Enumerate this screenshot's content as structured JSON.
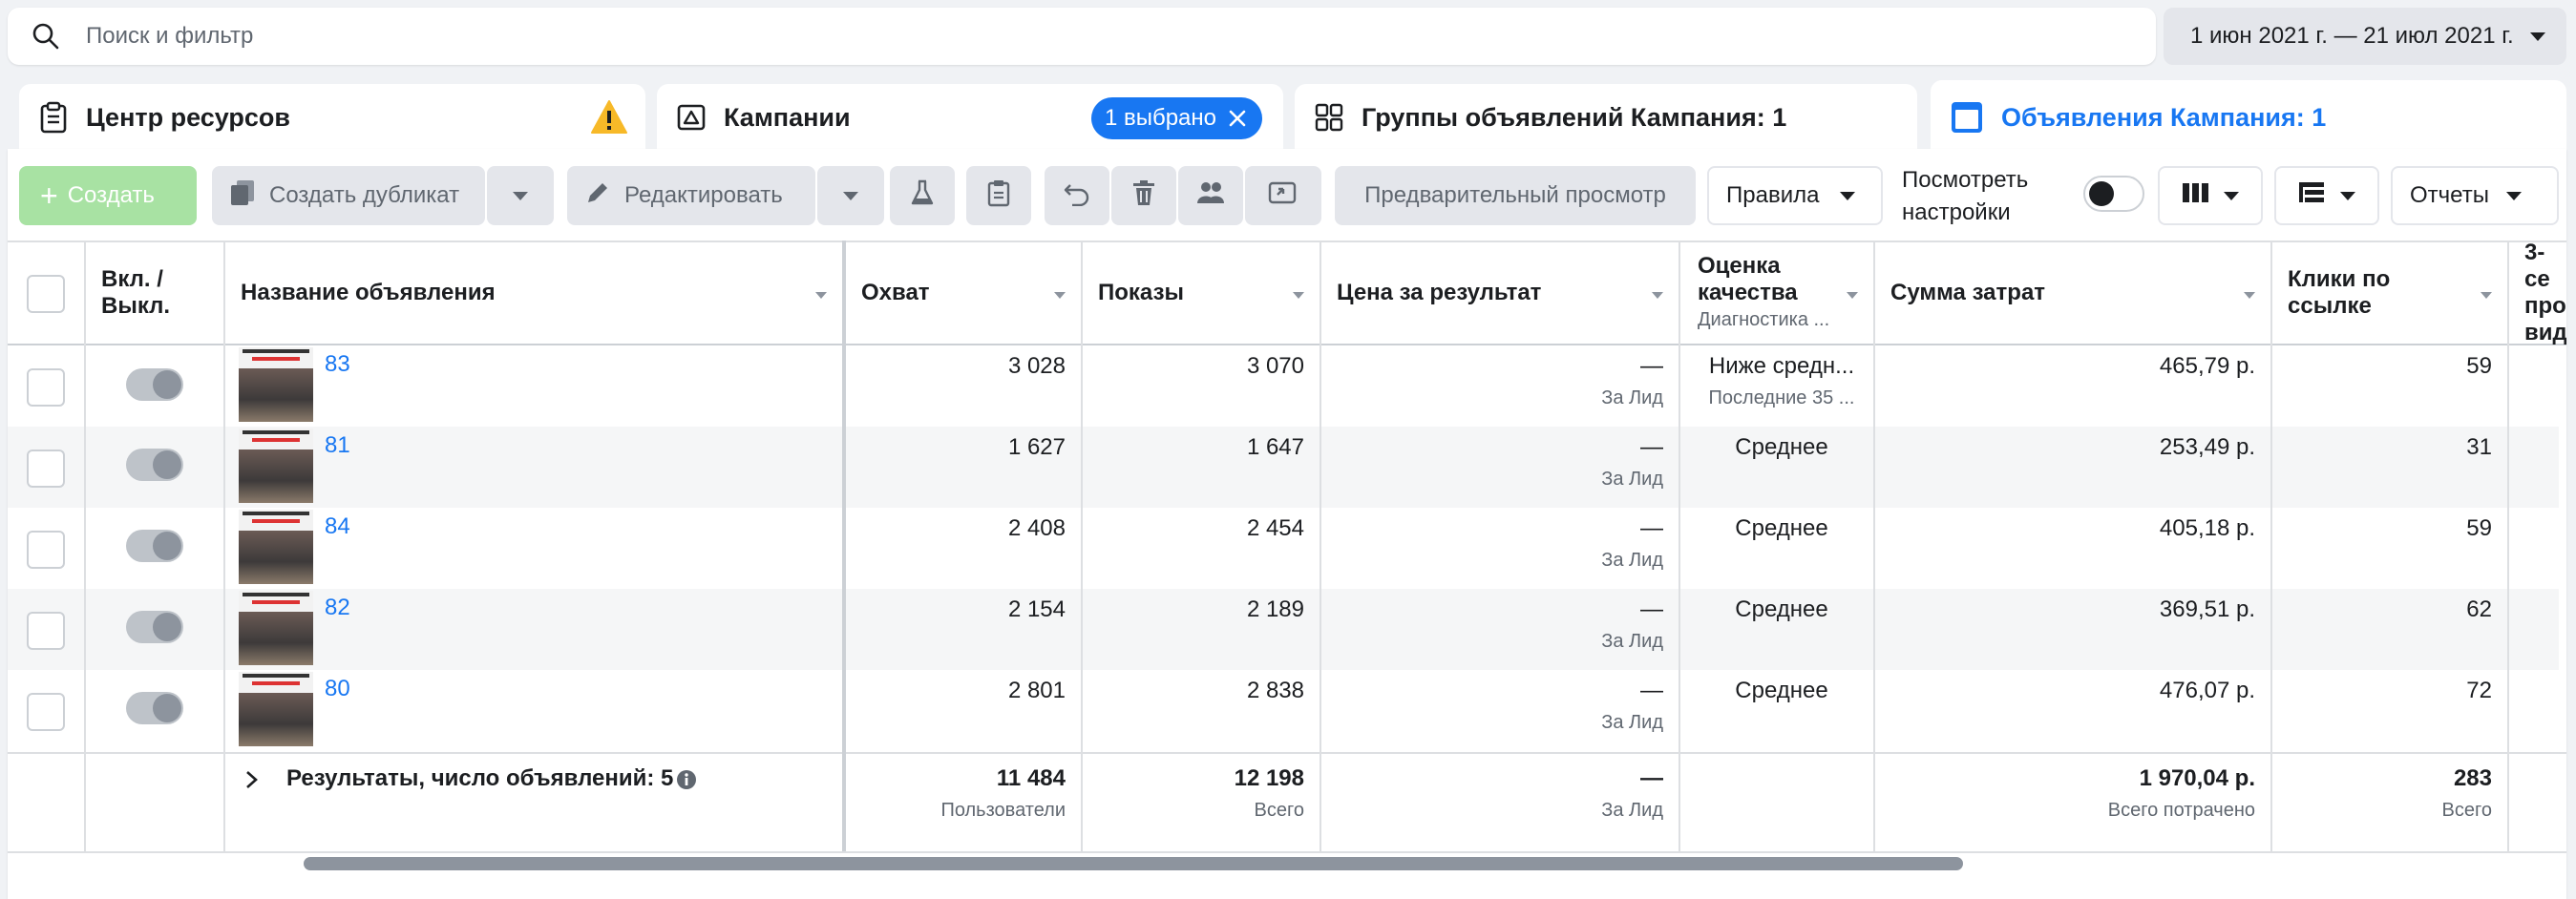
{
  "search": {
    "placeholder": "Поиск и фильтр"
  },
  "date_range": "1 июн 2021 г. — 21 июл 2021 г.",
  "tabs": [
    {
      "label": "Центр ресурсов"
    },
    {
      "label": "Кампании",
      "badge": "1 выбрано"
    },
    {
      "label": "Группы объявлений Кампания: 1"
    },
    {
      "label": "Объявления Кампания: 1"
    }
  ],
  "toolbar": {
    "create": "Создать",
    "duplicate": "Создать дубликат",
    "edit": "Редактировать",
    "preview": "Предварительный просмотр",
    "rules": "Правила",
    "view_settings_line1": "Посмотреть",
    "view_settings_line2": "настройки",
    "reports": "Отчеты"
  },
  "columns": {
    "onoff_line1": "Вкл. /",
    "onoff_line2": "Выкл.",
    "name": "Название объявления",
    "reach": "Охват",
    "impressions": "Показы",
    "cost_per_result": "Цена за результат",
    "quality_line1": "Оценка",
    "quality_line2": "качества",
    "quality_sub": "Диагностика ...",
    "spend": "Сумма затрат",
    "clicks_line1": "Клики по",
    "clicks_line2": "ссылке",
    "third_line1": "3-се",
    "third_line2": "про",
    "third_line3": "вид"
  },
  "rows": [
    {
      "name": "83",
      "reach": "3 028",
      "impressions": "3 070",
      "cost": "—",
      "cost_sub": "За Лид",
      "quality": "Ниже средн...",
      "quality_sub": "Последние 35 ...",
      "spend": "465,79 р.",
      "clicks": "59"
    },
    {
      "name": "81",
      "reach": "1 627",
      "impressions": "1 647",
      "cost": "—",
      "cost_sub": "За Лид",
      "quality": "Среднее",
      "quality_sub": "",
      "spend": "253,49 р.",
      "clicks": "31"
    },
    {
      "name": "84",
      "reach": "2 408",
      "impressions": "2 454",
      "cost": "—",
      "cost_sub": "За Лид",
      "quality": "Среднее",
      "quality_sub": "",
      "spend": "405,18 р.",
      "clicks": "59"
    },
    {
      "name": "82",
      "reach": "2 154",
      "impressions": "2 189",
      "cost": "—",
      "cost_sub": "За Лид",
      "quality": "Среднее",
      "quality_sub": "",
      "spend": "369,51 р.",
      "clicks": "62"
    },
    {
      "name": "80",
      "reach": "2 801",
      "impressions": "2 838",
      "cost": "—",
      "cost_sub": "За Лид",
      "quality": "Среднее",
      "quality_sub": "",
      "spend": "476,07 р.",
      "clicks": "72"
    }
  ],
  "totals": {
    "label": "Результаты, число объявлений: 5",
    "reach": "11 484",
    "reach_sub": "Пользователи",
    "impressions": "12 198",
    "impressions_sub": "Всего",
    "cost": "—",
    "cost_sub": "За Лид",
    "spend": "1 970,04 р.",
    "spend_sub": "Всего потрачено",
    "clicks": "283",
    "clicks_sub": "Всего"
  },
  "colors": {
    "accent": "#1877f2",
    "create_green": "#a8e2a3",
    "warning": "#f7b928"
  }
}
